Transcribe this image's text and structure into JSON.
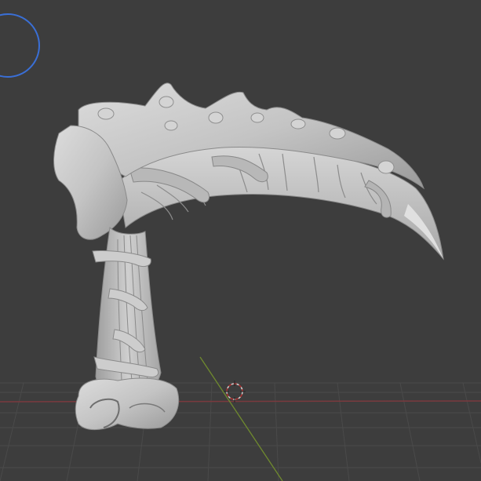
{
  "viewport": {
    "background_color": "#3d3d3d",
    "grid_color": "#4a4a4a",
    "x_axis_color": "#7a3a3e",
    "y_axis_color": "#6f8a2e",
    "mesh_color": "#c8c8c8",
    "navigation_gizmo_color": "#3a6fd6"
  },
  "scene": {
    "object": "sculpted-scythe",
    "cursor_icon": "3d-cursor-icon",
    "gizmo_icon": "navigation-circle-icon"
  }
}
